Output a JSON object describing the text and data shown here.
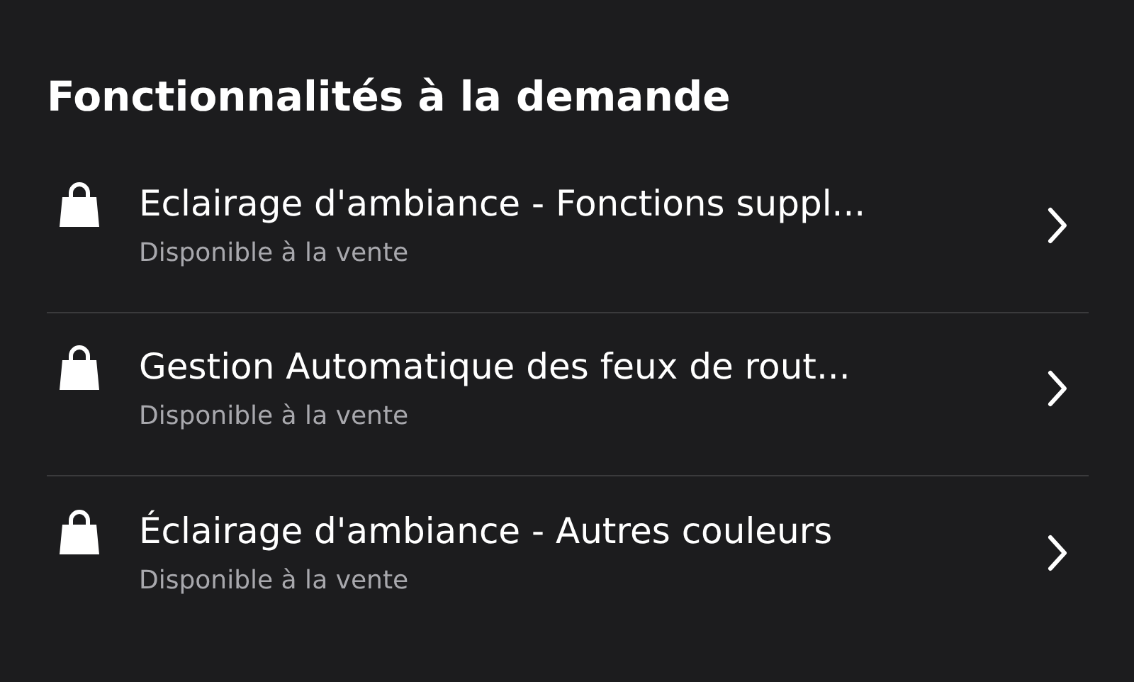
{
  "section": {
    "title": "Fonctionnalités à la demande"
  },
  "items": [
    {
      "title": "Eclairage d'ambiance - Fonctions suppl...",
      "subtitle": "Disponible à la vente"
    },
    {
      "title": "Gestion Automatique des feux de rout...",
      "subtitle": "Disponible à la vente"
    },
    {
      "title": "Éclairage d'ambiance - Autres couleurs",
      "subtitle": "Disponible à la vente"
    }
  ]
}
